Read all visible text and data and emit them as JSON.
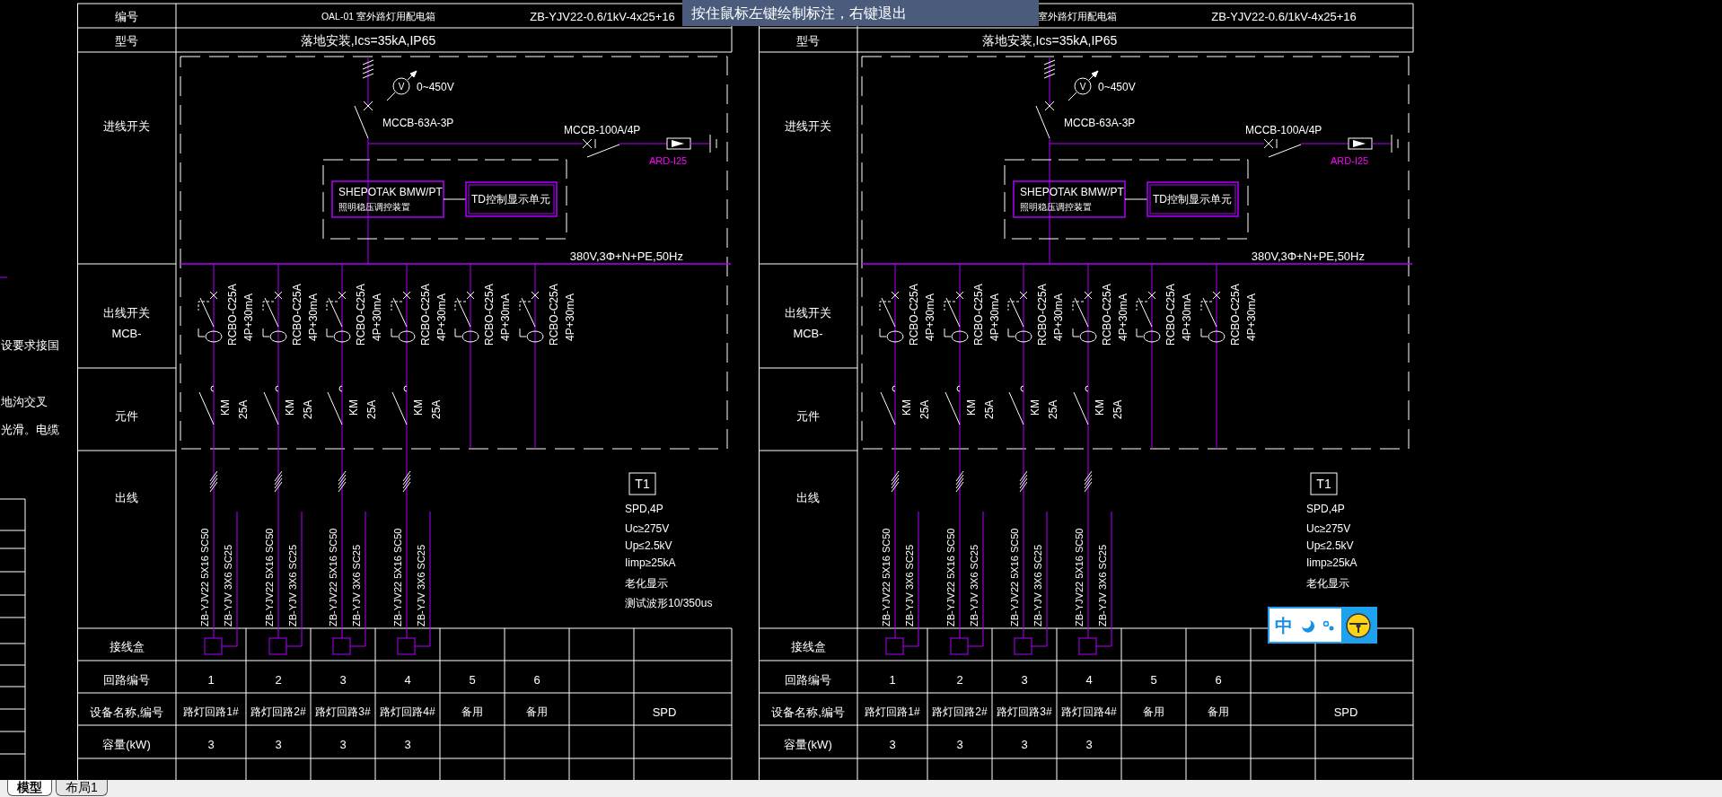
{
  "command_prompt": "按住鼠标左键绘制标注，右键退出",
  "side_notes": [
    "设要求接国",
    "地沟交叉",
    "光滑。电缆"
  ],
  "panels": [
    {
      "number_label": "编号",
      "title": "OAL-01 室外路灯用配电箱",
      "cable": "ZB-YJV22-0.6/1kV-4x25+16",
      "model_label": "型号",
      "model": "落地安装,Ics=35kA,IP65",
      "incoming_label": "进线开关",
      "meter_symbol": "V",
      "meter_range": "0~450V",
      "main_breaker": "MCCB-63A-3P",
      "branch_breaker": "MCCB-100A/4P",
      "monitor": "ARD-I25",
      "regulator": [
        "SHEPOTAK BMW/PT",
        "照明稳压调控装置"
      ],
      "display_unit": "TD控制显示单元",
      "supply": "380V,3Φ+N+PE,50Hz",
      "outgoing_switch_label": [
        "出线开关",
        "MCB-"
      ],
      "component_label": "元件",
      "outgoing_label": "出线",
      "junction_label": "接线盒",
      "circuit_no_label": "回路编号",
      "device_label": "设备名称,编号",
      "capacity_label": "容量(kW)",
      "circuits": [
        {
          "kind": "lighting",
          "rcbo": "RCBO-C25A",
          "rcbo_spec": "4P+30mA",
          "contactor": "KM",
          "contactor_rating": "25A",
          "cable_main": "ZB-YJV22 5X16 SC50",
          "cable_aux": "ZB-YJV 3X6 SC25",
          "number": "1",
          "device": "路灯回路1#",
          "capacity": "3"
        },
        {
          "kind": "lighting",
          "rcbo": "RCBO-C25A",
          "rcbo_spec": "4P+30mA",
          "contactor": "KM",
          "contactor_rating": "25A",
          "cable_main": "ZB-YJV22 5X16 SC50",
          "cable_aux": "ZB-YJV 3X6 SC25",
          "number": "2",
          "device": "路灯回路2#",
          "capacity": "3"
        },
        {
          "kind": "lighting",
          "rcbo": "RCBO-C25A",
          "rcbo_spec": "4P+30mA",
          "contactor": "KM",
          "contactor_rating": "25A",
          "cable_main": "ZB-YJV22 5X16 SC50",
          "cable_aux": "ZB-YJV 3X6 SC25",
          "number": "3",
          "device": "路灯回路3#",
          "capacity": "3"
        },
        {
          "kind": "lighting",
          "rcbo": "RCBO-C25A",
          "rcbo_spec": "4P+30mA",
          "contactor": "KM",
          "contactor_rating": "25A",
          "cable_main": "ZB-YJV22 5X16 SC50",
          "cable_aux": "ZB-YJV 3X6 SC25",
          "number": "4",
          "device": "路灯回路4#",
          "capacity": "3"
        },
        {
          "kind": "spare",
          "rcbo": "RCBO-C25A",
          "rcbo_spec": "4P+30mA",
          "number": "5",
          "device": "备用"
        },
        {
          "kind": "spare",
          "rcbo": "RCBO-C25A",
          "rcbo_spec": "4P+30mA",
          "number": "6",
          "device": "备用"
        }
      ],
      "spd": {
        "tag": "T1",
        "lines": [
          "SPD,4P",
          "Uc≥275V",
          "Up≤2.5kV",
          "Iimp≥25kA",
          "老化显示",
          "测试波形10/350us"
        ],
        "device": "SPD"
      }
    },
    {
      "title": "室外路灯用配电箱",
      "cable": "ZB-YJV22-0.6/1kV-4x25+16",
      "model_label": "型号",
      "model": "落地安装,Ics=35kA,IP65",
      "incoming_label": "进线开关",
      "meter_symbol": "V",
      "meter_range": "0~450V",
      "main_breaker": "MCCB-63A-3P",
      "branch_breaker": "MCCB-100A/4P",
      "monitor": "ARD-I25",
      "regulator": [
        "SHEPOTAK BMW/PT",
        "照明稳压调控装置"
      ],
      "display_unit": "TD控制显示单元",
      "supply": "380V,3Φ+N+PE,50Hz",
      "outgoing_switch_label": [
        "出线开关",
        "MCB-"
      ],
      "component_label": "元件",
      "outgoing_label": "出线",
      "junction_label": "接线盒",
      "circuit_no_label": "回路编号",
      "device_label": "设备名称,编号",
      "capacity_label": "容量(kW)",
      "circuits": [
        {
          "kind": "lighting",
          "rcbo": "RCBO-C25A",
          "rcbo_spec": "4P+30mA",
          "contactor": "KM",
          "contactor_rating": "25A",
          "cable_main": "ZB-YJV22 5X16 SC50",
          "cable_aux": "ZB-YJV 3X6 SC25",
          "number": "1",
          "device": "路灯回路1#",
          "capacity": "3"
        },
        {
          "kind": "lighting",
          "rcbo": "RCBO-C25A",
          "rcbo_spec": "4P+30mA",
          "contactor": "KM",
          "contactor_rating": "25A",
          "cable_main": "ZB-YJV22 5X16 SC50",
          "cable_aux": "ZB-YJV 3X6 SC25",
          "number": "2",
          "device": "路灯回路2#",
          "capacity": "3"
        },
        {
          "kind": "lighting",
          "rcbo": "RCBO-C25A",
          "rcbo_spec": "4P+30mA",
          "contactor": "KM",
          "contactor_rating": "25A",
          "cable_main": "ZB-YJV22 5X16 SC50",
          "cable_aux": "ZB-YJV 3X6 SC25",
          "number": "3",
          "device": "路灯回路3#",
          "capacity": "3"
        },
        {
          "kind": "lighting",
          "rcbo": "RCBO-C25A",
          "rcbo_spec": "4P+30mA",
          "contactor": "KM",
          "contactor_rating": "25A",
          "cable_main": "ZB-YJV22 5X16 SC50",
          "cable_aux": "ZB-YJV 3X6 SC25",
          "number": "4",
          "device": "路灯回路4#",
          "capacity": "3"
        },
        {
          "kind": "spare",
          "rcbo": "RCBO-C25A",
          "rcbo_spec": "4P+30mA",
          "number": "5",
          "device": "备用"
        },
        {
          "kind": "spare",
          "rcbo": "RCBO-C25A",
          "rcbo_spec": "4P+30mA",
          "number": "6",
          "device": "备用"
        }
      ],
      "spd": {
        "tag": "T1",
        "lines": [
          "SPD,4P",
          "Uc≥275V",
          "Up≤2.5kV",
          "Iimp≥25kA",
          "老化显示"
        ],
        "device": "SPD"
      }
    }
  ],
  "ime_toolbar": {
    "mode": "中"
  },
  "tabs": [
    {
      "label": "模型",
      "selected": true
    },
    {
      "label": "布局1",
      "selected": false
    }
  ]
}
